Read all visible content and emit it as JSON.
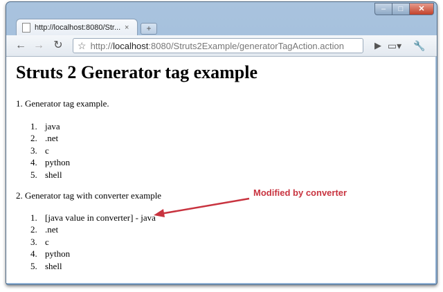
{
  "browser": {
    "tab_title": "http://localhost:8080/Str...",
    "tab_close": "×",
    "new_tab": "+",
    "window_controls": {
      "minimize": "–",
      "maximize": "□",
      "close": "✕"
    },
    "url_prefix": "http://",
    "url_host": "localhost",
    "url_rest": ":8080/Struts2Example/generatorTagAction.action",
    "icons": {
      "back": "back-arrow-icon",
      "forward": "forward-arrow-icon",
      "reload": "reload-icon",
      "bookmark": "star-icon",
      "go": "play-icon",
      "page": "page-menu-icon",
      "wrench": "wrench-icon"
    }
  },
  "page": {
    "title": "Struts 2 Generator tag example",
    "section1": "1. Generator tag example.",
    "list1": [
      "java",
      ".net",
      "c",
      "python",
      "shell"
    ],
    "section2": "2. Generator tag with converter example",
    "list2": [
      "[java value in converter] - java",
      ".net",
      "c",
      "python",
      "shell"
    ]
  },
  "annotation": {
    "text": "Modified by converter",
    "color": "#c8333f"
  }
}
